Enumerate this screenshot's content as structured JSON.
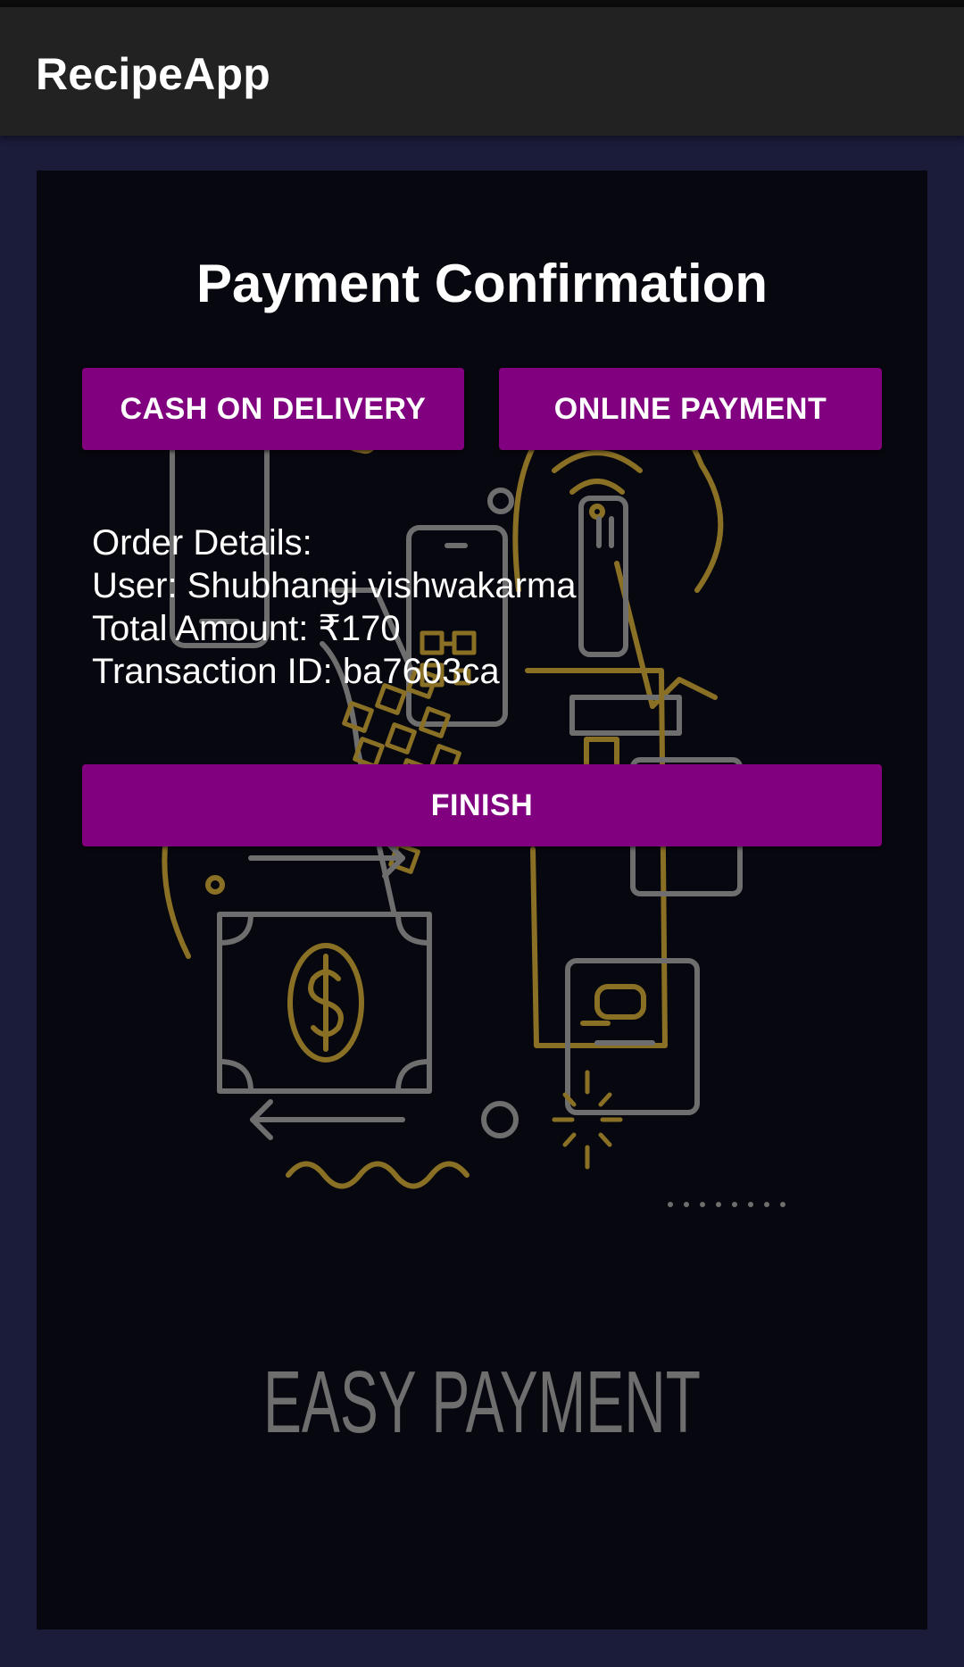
{
  "app_bar": {
    "title": "RecipeApp"
  },
  "page": {
    "title": "Payment Confirmation"
  },
  "payment_options": {
    "cash_on_delivery_label": "CASH ON DELIVERY",
    "online_payment_label": "ONLINE PAYMENT"
  },
  "order_details": {
    "heading": "Order Details:",
    "user_line": "User: Shubhangi vishwakarma",
    "amount_line": "Total Amount: ₹170",
    "transaction_line": "Transaction ID: ba7603ca"
  },
  "actions": {
    "finish_label": "FINISH"
  },
  "background": {
    "caption": "EASY PAYMENT"
  },
  "colors": {
    "app_bar": "#222222",
    "page_background": "#1b1b3a",
    "card_background": "#07070f",
    "button": "#800080",
    "illustration_gold": "#8a7025",
    "illustration_gray": "#6e6e6e"
  },
  "icons": [
    "phone-icon",
    "credit-card-icon",
    "dollar-bill-icon",
    "calculator-icon",
    "wifi-icon",
    "arrow-left-icon",
    "arrow-right-icon"
  ]
}
